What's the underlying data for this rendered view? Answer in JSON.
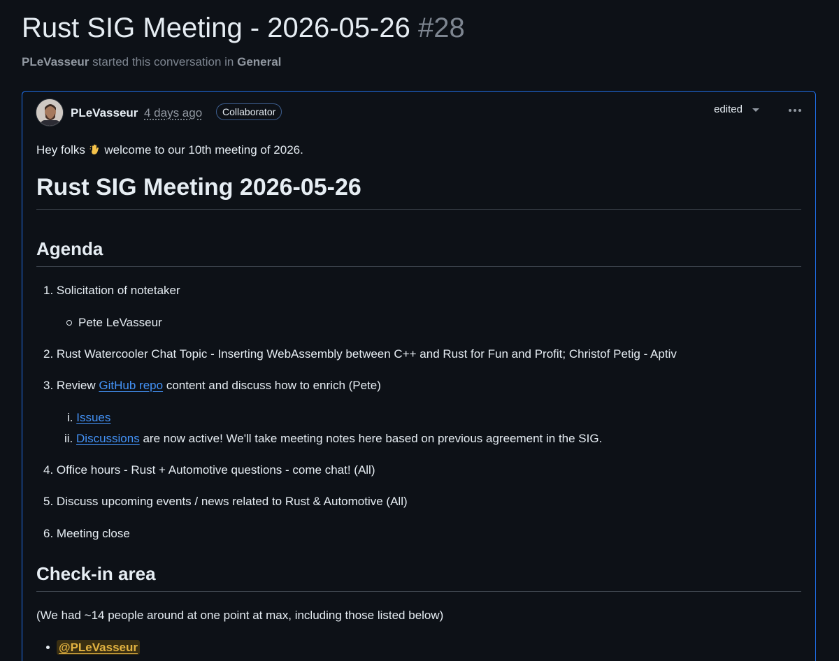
{
  "discussion": {
    "title": "Rust SIG Meeting - 2026-05-26",
    "number": "#28",
    "author": "PLeVasseur",
    "subtitle_middle": "started this conversation in",
    "category": "General"
  },
  "post": {
    "author": "PLeVasseur",
    "time": "4 days ago",
    "badge": "Collaborator",
    "edited_label": "edited",
    "intro_before": "Hey folks",
    "intro_after": "welcome to our 10th meeting of 2026.",
    "heading": "Rust SIG Meeting 2026-05-26",
    "agenda_heading": "Agenda",
    "agenda": [
      {
        "marker": "1.",
        "text": "Solicitation of notetaker"
      },
      {
        "marker": "2.",
        "text": "Rust Watercooler Chat Topic - Inserting WebAssembly between C++ and Rust for Fun and Profit; Christof Petig - Aptiv"
      },
      {
        "marker": "3.",
        "before": "Review",
        "link": "GitHub repo",
        "after": "content and discuss how to enrich (Pete)"
      },
      {
        "marker": "4.",
        "text": "Office hours - Rust + Automotive questions - come chat! (All)"
      },
      {
        "marker": "5.",
        "text": "Discuss upcoming events / news related to Rust & Automotive (All)"
      },
      {
        "marker": "6.",
        "text": "Meeting close"
      }
    ],
    "notetaker": "Pete LeVasseur",
    "sub_items": [
      {
        "marker": "i.",
        "link": "Issues",
        "after": ""
      },
      {
        "marker": "ii.",
        "link": "Discussions",
        "after": "are now active! We'll take meeting notes here based on previous agreement in the SIG."
      }
    ],
    "checkin_heading": "Check-in area",
    "checkin_text": "(We had ~14 people around at one point at max, including those listed below)",
    "attendees": [
      "@PLeVasseur"
    ]
  }
}
